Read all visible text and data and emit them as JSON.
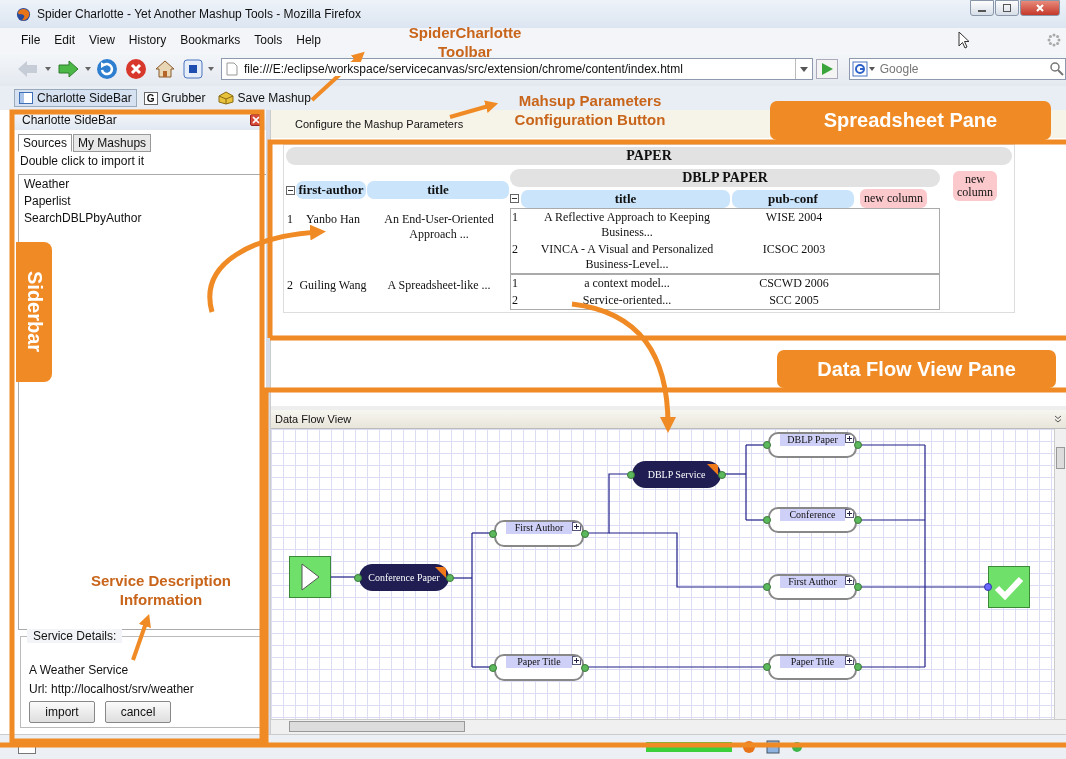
{
  "window": {
    "title": "Spider Charlotte - Yet Another Mashup Tools - Mozilla Firefox"
  },
  "menu": [
    "File",
    "Edit",
    "View",
    "History",
    "Bookmarks",
    "Tools",
    "Help"
  ],
  "navigation": {
    "url": "file:///E:/eclipse/workspace/servicecanvas/src/extension/chrome/content/index.html",
    "search_placeholder": "Google"
  },
  "bookmarks": [
    {
      "kind": "panel",
      "label": "Charlotte SideBar",
      "selected": true
    },
    {
      "kind": "letter",
      "icon_text": "G",
      "label": "Grubber",
      "selected": false
    },
    {
      "kind": "package",
      "label": "Save Mashup",
      "selected": false
    }
  ],
  "sidebar": {
    "title": "Charlotte SideBar",
    "tabs": [
      {
        "label": "Sources",
        "selected": true
      },
      {
        "label": "My Mashups",
        "selected": false
      }
    ],
    "hint": "Double click to import it",
    "items": [
      "Weather",
      "Paperlist",
      "SearchDBLPbyAuthor"
    ],
    "details": {
      "legend": "Service Details:",
      "description": "A Weather Service",
      "url": "Url: http://localhost/srv/weather",
      "buttons": [
        "import",
        "cancel"
      ]
    }
  },
  "parameters_button": "Configure the Mashup Parameters",
  "spreadsheet": {
    "title": "PAPER",
    "columns": [
      "first-author",
      "title"
    ],
    "group": {
      "title": "DBLP PAPER",
      "columns": [
        "title",
        "pub-conf"
      ],
      "new_column": "new column"
    },
    "new_column": "new column",
    "rows": [
      {
        "index": "1",
        "cells": [
          "Yanbo Han",
          "An End-User-Oriented Approach ..."
        ],
        "sub_rows": [
          {
            "index": "1",
            "cells": [
              "A Reflective Approach to Keeping Business...",
              "WISE 2004"
            ]
          },
          {
            "index": "2",
            "cells": [
              "VINCA - A Visual and Personalized Business-Level...",
              "ICSOC 2003"
            ]
          }
        ]
      },
      {
        "index": "2",
        "cells": [
          "Guiling Wang",
          "A Spreadsheet-like ..."
        ],
        "sub_rows": [
          {
            "index": "1",
            "cells": [
              "a context model...",
              "CSCWD 2006"
            ]
          },
          {
            "index": "2",
            "cells": [
              "Service-oriented...",
              "SCC 2005"
            ]
          }
        ]
      }
    ]
  },
  "data_flow": {
    "title": "Data Flow View",
    "nodes": [
      {
        "kind": "start"
      },
      {
        "kind": "service",
        "label": "Conference Paper"
      },
      {
        "kind": "field",
        "label": "First Author"
      },
      {
        "kind": "field",
        "label": "Paper Title"
      },
      {
        "kind": "service",
        "label": "DBLP Service"
      },
      {
        "kind": "field",
        "label": "DBLP Paper"
      },
      {
        "kind": "field",
        "label": "Conference"
      },
      {
        "kind": "field",
        "label": "First Author"
      },
      {
        "kind": "field",
        "label": "Paper Title"
      },
      {
        "kind": "end"
      }
    ]
  },
  "annotations": [
    {
      "kind": "caption",
      "text": "SpiderCharlotte Toolbar"
    },
    {
      "kind": "caption",
      "text": "Mahsup Parameters Configuration Button"
    },
    {
      "kind": "tag",
      "text": "Spreadsheet Pane"
    },
    {
      "kind": "vertical-tag",
      "text": "Siderbar"
    },
    {
      "kind": "tag",
      "text": "Data Flow View Pane"
    },
    {
      "kind": "caption",
      "text": "Service Description Information"
    }
  ]
}
